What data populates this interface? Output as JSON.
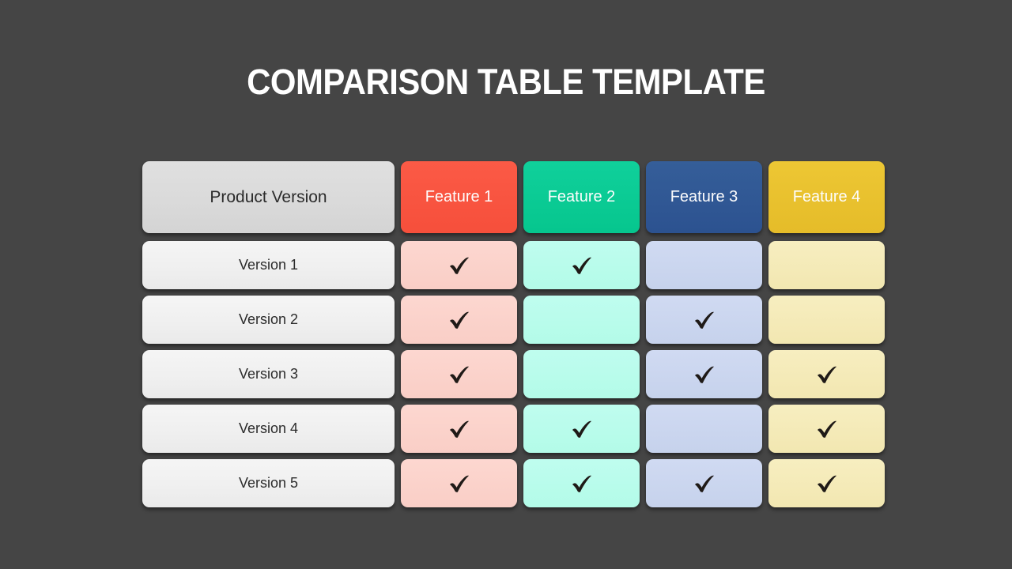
{
  "slide": {
    "title": "COMPARISON TABLE TEMPLATE",
    "background_color": "#454545",
    "title_color": "#FFFFFF"
  },
  "table": {
    "header": {
      "label_column": "Product Version",
      "feature_columns": [
        {
          "label": "Feature 1",
          "color": "#F9503E",
          "body_color": "#FBD3CC"
        },
        {
          "label": "Feature 2",
          "color": "#0ACB95",
          "body_color": "#B9FCEC"
        },
        {
          "label": "Feature 3",
          "color": "#2F5894",
          "body_color": "#CBD6EF"
        },
        {
          "label": "Feature 4",
          "color": "#E9C22F",
          "body_color": "#F5EBB8"
        }
      ]
    },
    "rows": [
      {
        "label": "Version 1",
        "checks": [
          true,
          true,
          false,
          false
        ]
      },
      {
        "label": "Version 2",
        "checks": [
          true,
          false,
          true,
          false
        ]
      },
      {
        "label": "Version 3",
        "checks": [
          true,
          false,
          true,
          true
        ]
      },
      {
        "label": "Version 4",
        "checks": [
          true,
          true,
          false,
          true
        ]
      },
      {
        "label": "Version 5",
        "checks": [
          true,
          true,
          true,
          true
        ]
      }
    ],
    "check_icon": "check-mark",
    "check_color": "#1F1A17"
  }
}
